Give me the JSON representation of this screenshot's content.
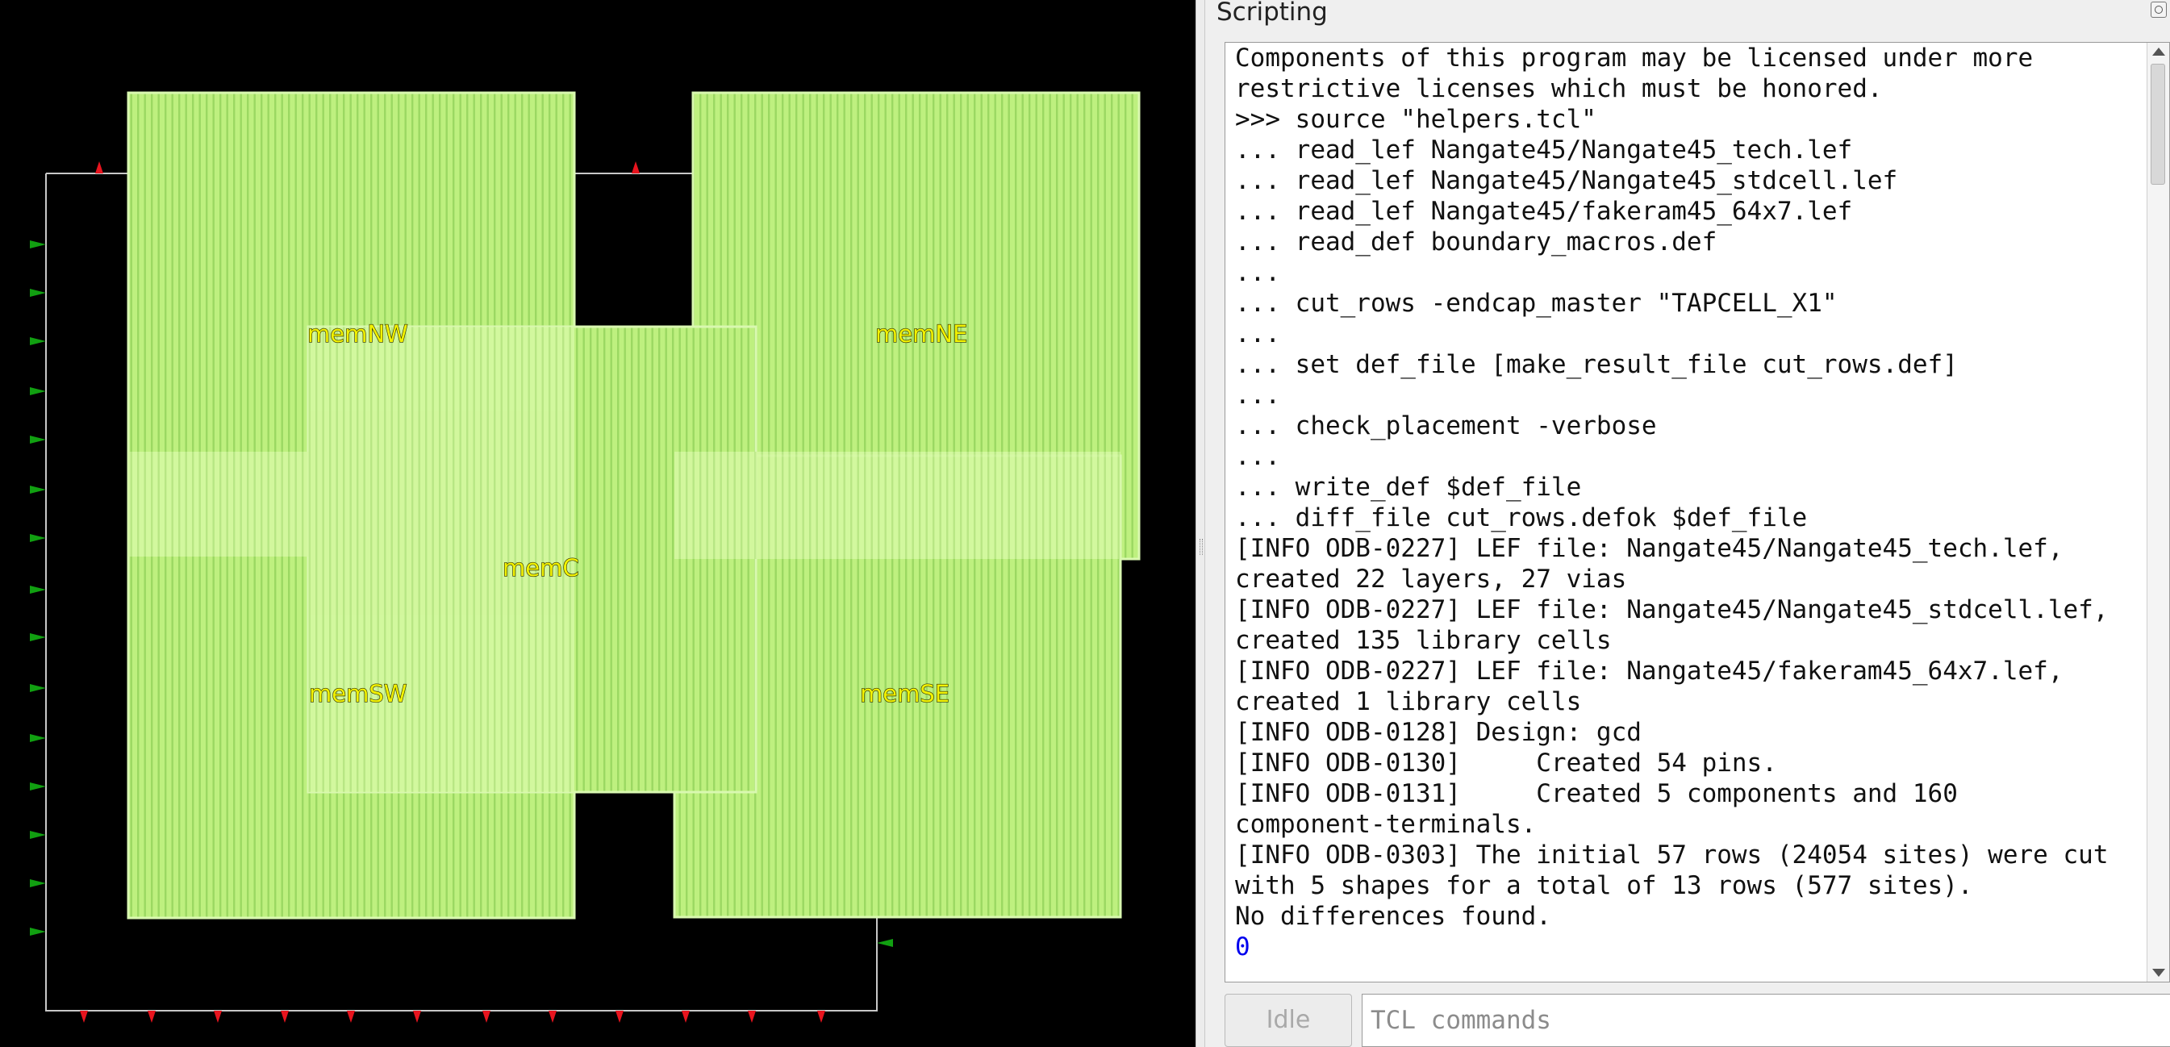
{
  "layout": {
    "macros": [
      {
        "name": "memNW"
      },
      {
        "name": "memNE"
      },
      {
        "name": "memC"
      },
      {
        "name": "memSW"
      },
      {
        "name": "memSE"
      }
    ],
    "colors": {
      "macro_fill": "#bef07f",
      "macro_stripe": "#9bd862",
      "macro_overlap": "#d6f9a3",
      "label": "#f2f200",
      "boundary": "#c8c8c8",
      "pin_red": "#e8141e",
      "pin_green": "#11a011"
    }
  },
  "scripting": {
    "title": "Scripting",
    "output_lines": [
      "Components of this program may be licensed under more",
      "restrictive licenses which must be honored.",
      ">>> source \"helpers.tcl\"",
      "... read_lef Nangate45/Nangate45_tech.lef",
      "... read_lef Nangate45/Nangate45_stdcell.lef",
      "... read_lef Nangate45/fakeram45_64x7.lef",
      "... read_def boundary_macros.def",
      "...",
      "... cut_rows -endcap_master \"TAPCELL_X1\"",
      "...",
      "... set def_file [make_result_file cut_rows.def]",
      "...",
      "... check_placement -verbose",
      "...",
      "... write_def $def_file",
      "... diff_file cut_rows.defok $def_file",
      "[INFO ODB-0227] LEF file: Nangate45/Nangate45_tech.lef,",
      "created 22 layers, 27 vias",
      "[INFO ODB-0227] LEF file: Nangate45/Nangate45_stdcell.lef,",
      "created 135 library cells",
      "[INFO ODB-0227] LEF file: Nangate45/fakeram45_64x7.lef,",
      "created 1 library cells",
      "[INFO ODB-0128] Design: gcd",
      "[INFO ODB-0130]     Created 54 pins.",
      "[INFO ODB-0131]     Created 5 components and 160",
      "component-terminals.",
      "[INFO ODB-0303] The initial 57 rows (24054 sites) were cut",
      "with 5 shapes for a total of 13 rows (577 sites).",
      "No differences found."
    ],
    "result_value": "0",
    "status_label": "Idle",
    "input_placeholder": "TCL commands",
    "input_value": "",
    "colors": {
      "result": "#0000ee",
      "panel_bg": "#efefef"
    }
  }
}
